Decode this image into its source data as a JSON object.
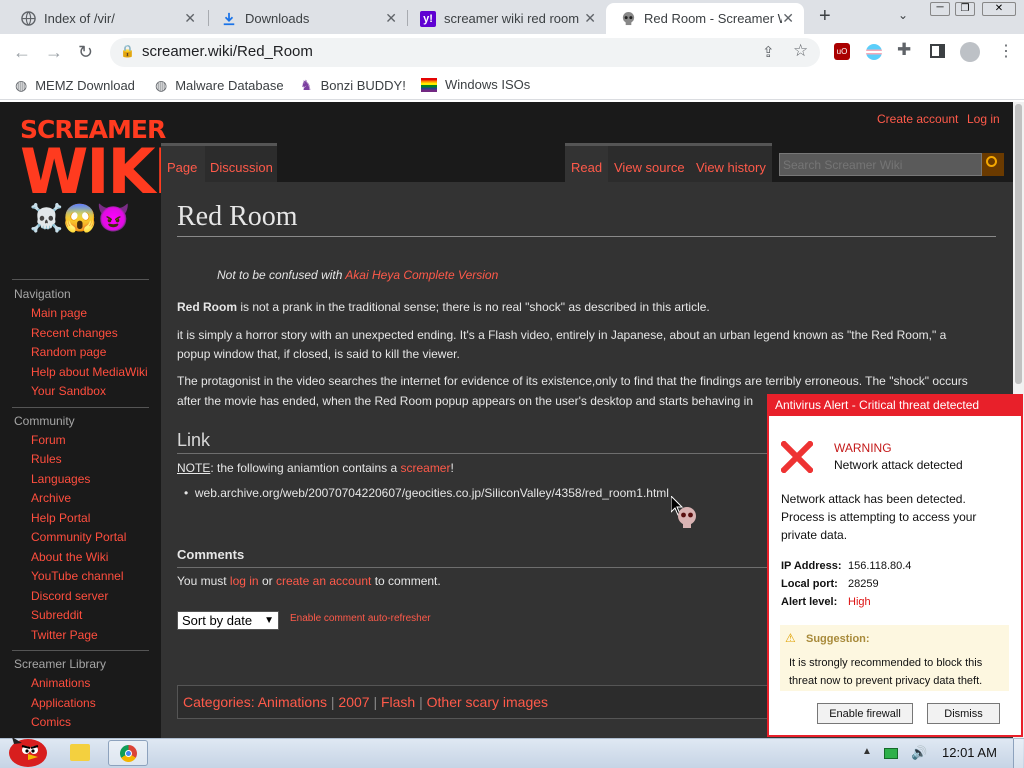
{
  "browser": {
    "tabs": [
      {
        "title": "Index of /vir/",
        "icon": "globe-icon"
      },
      {
        "title": "Downloads",
        "icon": "download-icon"
      },
      {
        "title": "screamer wiki red room",
        "icon": "yahoo-icon"
      },
      {
        "title": "Red Room - Screamer W",
        "icon": "skull-icon"
      }
    ],
    "url": "screamer.wiki/Red_Room",
    "bookmarks": [
      {
        "label": "MEMZ Download",
        "icon": "globe-icon"
      },
      {
        "label": "Malware Database",
        "icon": "globe-icon"
      },
      {
        "label": "Bonzi BUDDY!",
        "icon": "bonzi-icon"
      },
      {
        "label": "Windows ISOs",
        "icon": "windows-icon"
      }
    ]
  },
  "wiki": {
    "logo": {
      "line1": "SCREAMER",
      "line2": "WIKI",
      "emoji": "☠️😱😈"
    },
    "top_links": {
      "create": "Create account",
      "login": "Log in"
    },
    "tabs": {
      "page": "Page",
      "discussion": "Discussion",
      "read": "Read",
      "view_source": "View source",
      "view_history": "View history"
    },
    "search_placeholder": "Search Screamer Wiki",
    "sidebar": {
      "navigation_header": "Navigation",
      "navigation": [
        "Main page",
        "Recent changes",
        "Random page",
        "Help about MediaWiki",
        "Your Sandbox"
      ],
      "community_header": "Community",
      "community": [
        "Forum",
        "Rules",
        "Languages",
        "Archive",
        "Help Portal",
        "Community Portal",
        "About the Wiki",
        "YouTube channel",
        "Discord server",
        "Subreddit",
        "Twitter Page"
      ],
      "library_header": "Screamer Library",
      "library": [
        "Animations",
        "Applications",
        "Comics"
      ]
    },
    "title": "Red Room",
    "hatnote": {
      "prefix": "Not to be confused with ",
      "link": "Akai Heya Complete Version"
    },
    "p1": {
      "bold": "Red Room",
      "rest": " is not a prank in the traditional sense; there is no real \"shock\" as described in this article."
    },
    "p2_line1": "it is simply a horror story with an unexpected ending. It's a Flash video, entirely in Japanese, about an urban legend known as \"the Red Room,\" a",
    "p2_line2": "popup window that, if closed, is said to kill the viewer.",
    "p3_line1": "The protagonist in the video searches the internet for evidence of its existence,only to find that the findings are terribly erroneous. The \"shock\" occurs",
    "p3_line2": "after the movie has ended, when the Red Room popup appears on the user's desktop and starts behaving in",
    "link_heading": "Link",
    "note": {
      "label": "NOTE",
      "text": ": the following aniamtion contains a ",
      "link": "screamer",
      "end": "!"
    },
    "archive_link": "web.archive.org/web/20070704220607/geocities.co.jp/SiliconValley/4358/red_room1.html",
    "comments_heading": "Comments",
    "comment_prompt": {
      "a": "You must ",
      "login": "log in",
      "b": " or ",
      "create": "create an account",
      "c": " to comment."
    },
    "sort_value": "Sort by date",
    "auto_refresh": "Enable comment auto-refresher",
    "categories_label": "Categories:",
    "categories": [
      "Animations",
      "2007",
      "Flash",
      "Other scary images"
    ]
  },
  "alert": {
    "title": "Antivirus Alert - Critical threat detected",
    "warning": "WARNING",
    "subtitle": "Network attack detected",
    "body": [
      "Network attack has been detected.",
      "Process is attempting to access your",
      "private data."
    ],
    "fields": [
      {
        "label": "IP Address:",
        "value": "156.118.80.4"
      },
      {
        "label": "Local port:",
        "value": "28259"
      },
      {
        "label": "Alert level:",
        "value": "High"
      }
    ],
    "suggestion_title": "Suggestion:",
    "suggestion": [
      "It is strongly recommended to block this",
      "threat now to prevent privacy data theft."
    ],
    "btn_firewall": "Enable firewall",
    "btn_dismiss": "Dismiss"
  },
  "taskbar": {
    "clock": "12:01 AM"
  },
  "colors": {
    "link": "#ff5a4a",
    "alert_red": "#e8202a",
    "content_bg": "#333333"
  }
}
